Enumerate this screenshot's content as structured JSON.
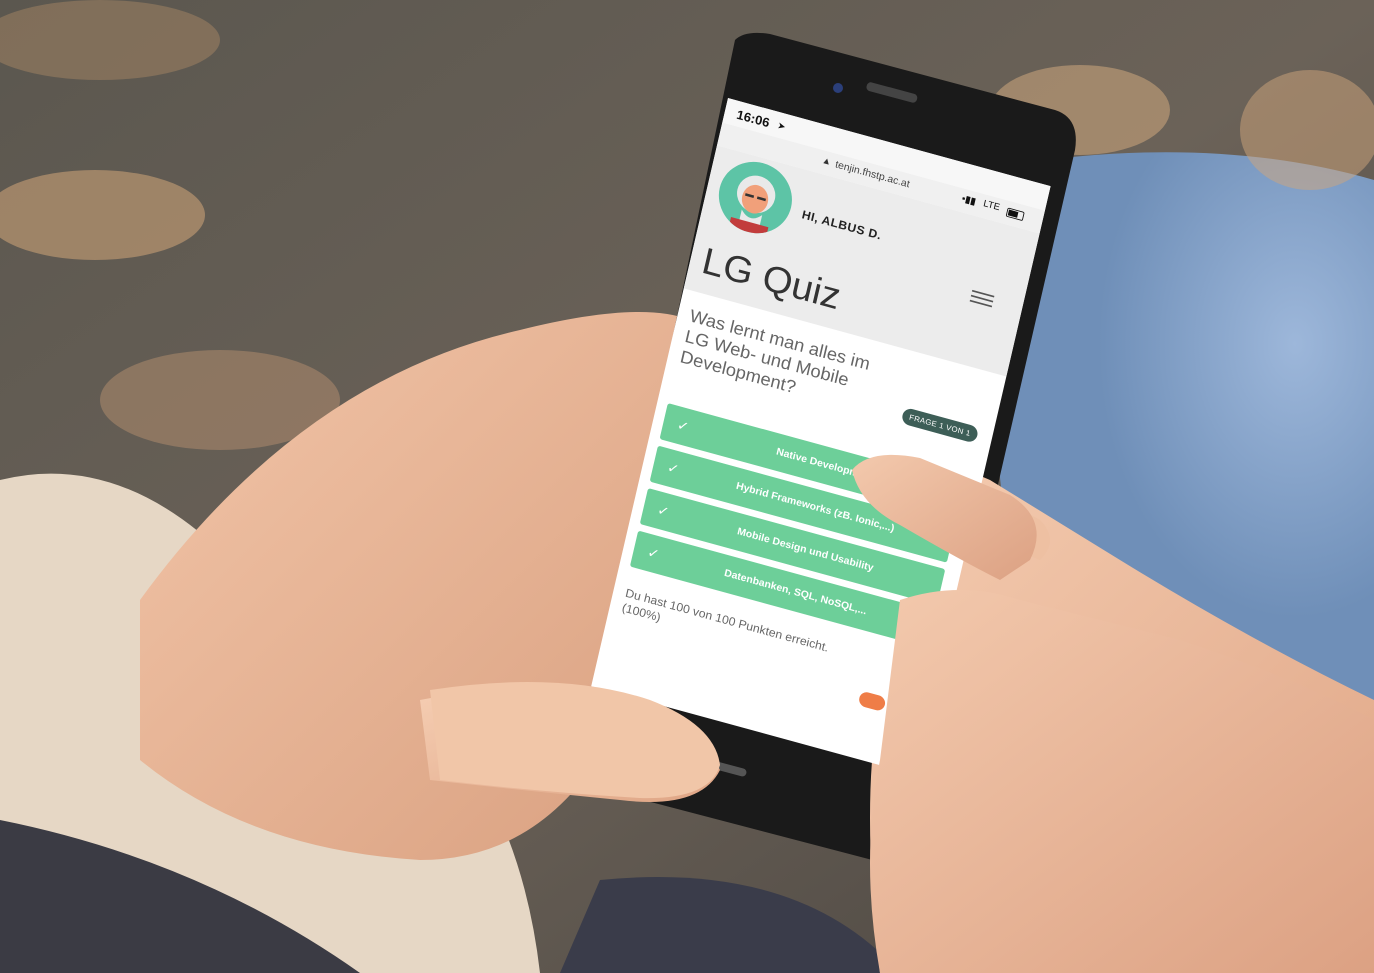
{
  "status_bar": {
    "time": "16:06",
    "network": "LTE"
  },
  "browser": {
    "url": "tenjin.fhstp.ac.at"
  },
  "user": {
    "greeting": "HI, ALBUS D."
  },
  "quiz": {
    "title": "LG Quiz",
    "question": "Was lernt man alles im LG Web- und Mobile Development?",
    "progress_badge": "FRAGE 1 VON 1",
    "answers": [
      {
        "label": "Native Development",
        "correct": true
      },
      {
        "label": "Hybrid Frameworks (zB. Ionic,...)",
        "correct": true
      },
      {
        "label": "Mobile Design und Usability",
        "correct": true
      },
      {
        "label": "Datenbanken, SQL, NoSQL,...",
        "correct": true
      }
    ],
    "score_text": "Du hast 100 von 100 Punkten erreicht. (100%)"
  },
  "colors": {
    "answer_green": "#6dcf99",
    "badge": "#3d5e57",
    "avatar_bg": "#5dc4a6",
    "accent_orange": "#ef7d47"
  },
  "icons": [
    "location-arrow-icon",
    "lock-icon",
    "signal-icon",
    "battery-icon",
    "menu-icon",
    "check-icon"
  ]
}
